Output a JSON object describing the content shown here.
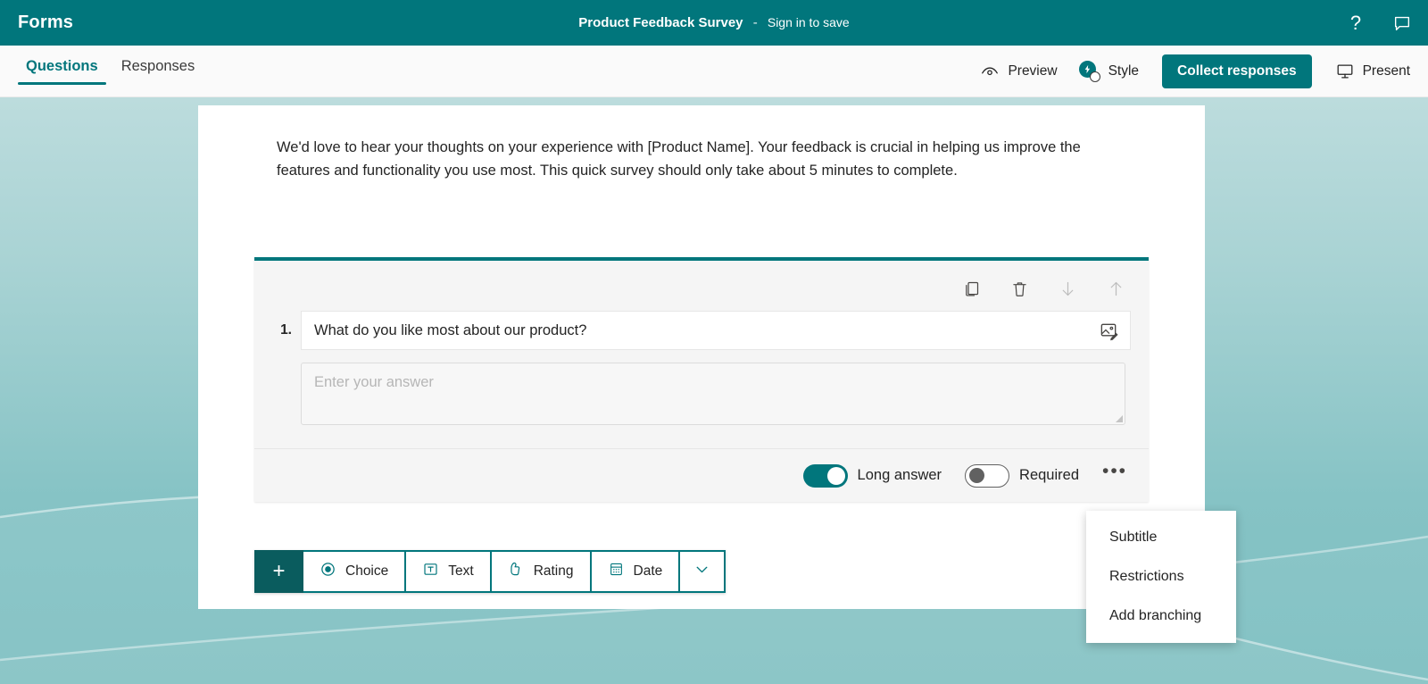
{
  "app": {
    "brand": "Forms",
    "accent_color": "#01767c",
    "background_gradient_top": "#bcdcdd",
    "background_gradient_bottom": "#7dbfc1"
  },
  "header": {
    "title": "Product Feedback Survey",
    "separator": "-",
    "sign_in": "Sign in to save",
    "help_icon": "?",
    "help_icon_name": "help-icon",
    "feedback_icon_name": "feedback-icon"
  },
  "tabs": [
    {
      "label": "Questions",
      "active": true
    },
    {
      "label": "Responses",
      "active": false
    }
  ],
  "toolbar": {
    "preview_label": "Preview",
    "style_label": "Style",
    "collect_label": "Collect responses",
    "present_label": "Present"
  },
  "form": {
    "description": "We'd love to hear your thoughts on your experience with [Product Name]. Your feedback is crucial in helping us improve the features and functionality you use most. This quick survey should only take about 5 minutes to complete."
  },
  "question": {
    "number": "1.",
    "text": "What do you like most about our product?",
    "answer_placeholder": "Enter your answer",
    "long_answer_label": "Long answer",
    "long_answer_on": true,
    "required_label": "Required",
    "required_on": false,
    "more_glyph": "•••",
    "tools": [
      {
        "name": "copy-question-icon",
        "dim": false
      },
      {
        "name": "delete-question-icon",
        "dim": false
      },
      {
        "name": "move-down-icon",
        "dim": true
      },
      {
        "name": "move-up-icon",
        "dim": true
      }
    ]
  },
  "add_question_bar": {
    "plus_glyph": "+",
    "items": [
      {
        "label": "Choice",
        "icon": "radio-choice-icon"
      },
      {
        "label": "Text",
        "icon": "text-box-icon"
      },
      {
        "label": "Rating",
        "icon": "thumbs-up-icon"
      },
      {
        "label": "Date",
        "icon": "calendar-icon"
      }
    ],
    "expand_icon": "chevron-down-icon"
  },
  "context_menu": {
    "items": [
      {
        "label": "Subtitle"
      },
      {
        "label": "Restrictions"
      },
      {
        "label": "Add branching"
      }
    ]
  }
}
